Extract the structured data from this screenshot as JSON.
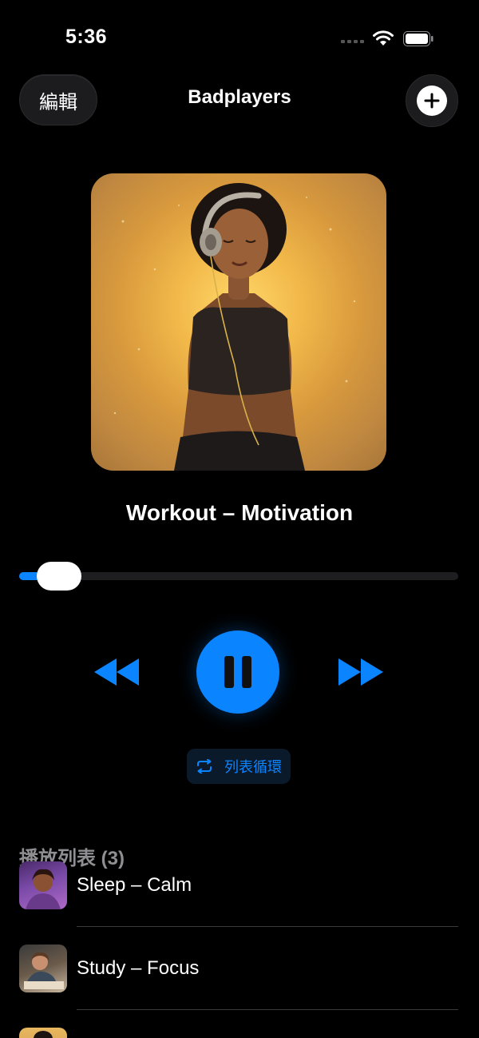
{
  "status_bar": {
    "time": "5:36"
  },
  "header": {
    "edit_label": "編輯",
    "title": "Badplayers"
  },
  "now_playing": {
    "title": "Workout – Motivation",
    "progress": 0.04
  },
  "repeat": {
    "label": "列表循環"
  },
  "playlist": {
    "header": "播放列表 (3)",
    "items": [
      {
        "title": "Sleep – Calm"
      },
      {
        "title": "Study – Focus"
      },
      {
        "title": ""
      }
    ]
  },
  "colors": {
    "accent": "#0a84ff",
    "background": "#000000",
    "secondary_text": "#8e8e93"
  }
}
